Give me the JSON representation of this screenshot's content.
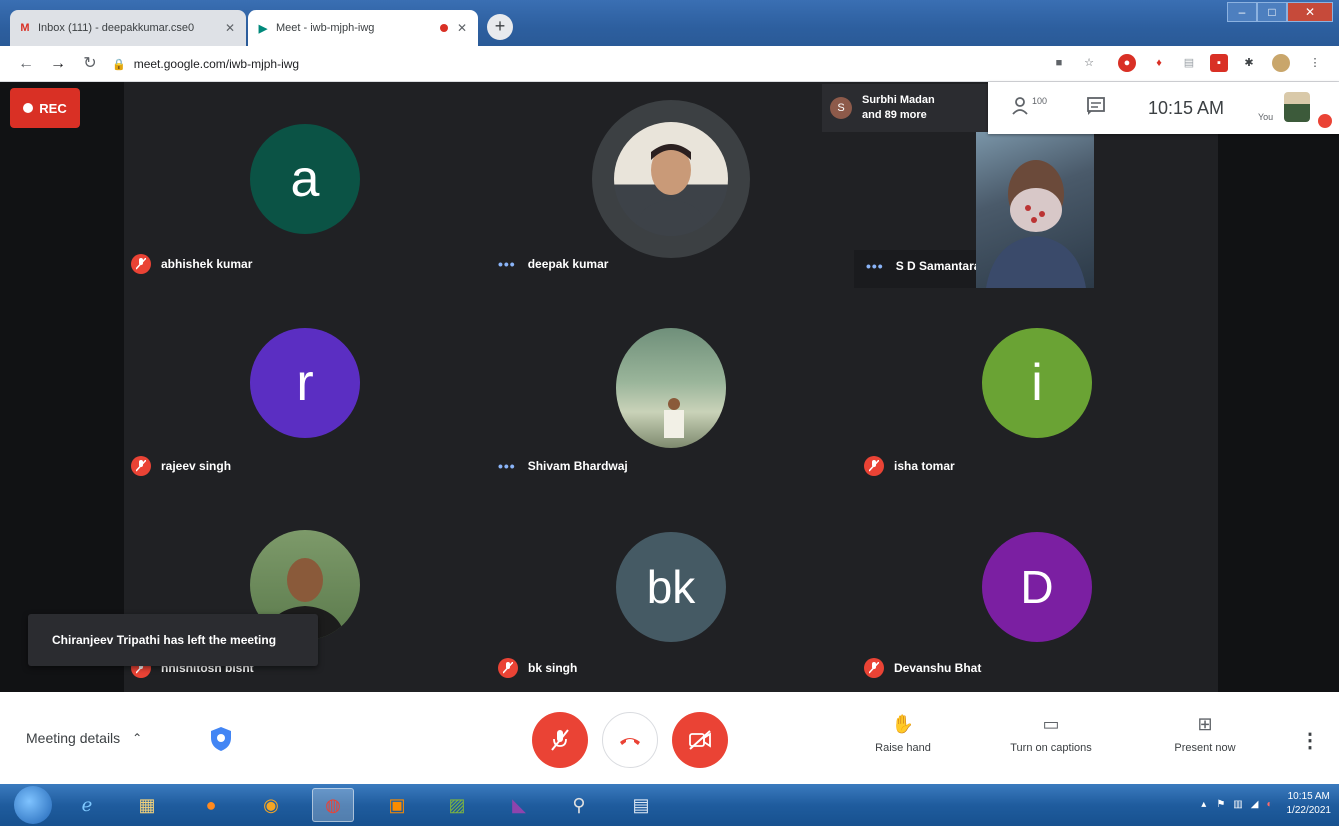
{
  "browser": {
    "tabs": [
      {
        "favicon": "gmail-icon",
        "title": "Inbox (111) - deepakkumar.cse0"
      },
      {
        "favicon": "meet-icon",
        "title": "Meet - iwb-mjph-iwg"
      }
    ],
    "url": "meet.google.com/iwb-mjph-iwg"
  },
  "meeting": {
    "rec_label": "REC",
    "participants_pill": {
      "initial": "S",
      "line1": "Surbhi Madan",
      "line2": "and 89 more"
    },
    "header": {
      "participant_count": "100",
      "time": "10:15 AM",
      "you_label": "You"
    },
    "tiles": [
      {
        "name": "abhishek kumar",
        "initial": "a",
        "color": "#0b5345"
      },
      {
        "name": "deepak kumar"
      },
      {
        "name": "S D Samantaray"
      },
      {
        "name": "rajeev singh",
        "initial": "r",
        "color": "#5b2ec2"
      },
      {
        "name": "Shivam Bhardwaj"
      },
      {
        "name": "isha tomar",
        "initial": "i",
        "color": "#6aa334"
      },
      {
        "name": "nnishitosh bisht"
      },
      {
        "name": "bk singh",
        "initial": "bk",
        "color": "#455a64"
      },
      {
        "name": "Devanshu Bhat",
        "initial": "D",
        "color": "#7b1fa2"
      }
    ],
    "toast": "Chiranjeev Tripathi has left the meeting"
  },
  "controls": {
    "meeting_details": "Meeting details",
    "raise_hand": "Raise hand",
    "captions": "Turn on captions",
    "present": "Present now"
  },
  "taskbar": {
    "time": "10:15 AM",
    "date": "1/22/2021"
  },
  "colors": {
    "red": "#ea4335",
    "meet_bg": "#202124",
    "rec": "#d93025",
    "speaking": "#8ab4f8"
  }
}
